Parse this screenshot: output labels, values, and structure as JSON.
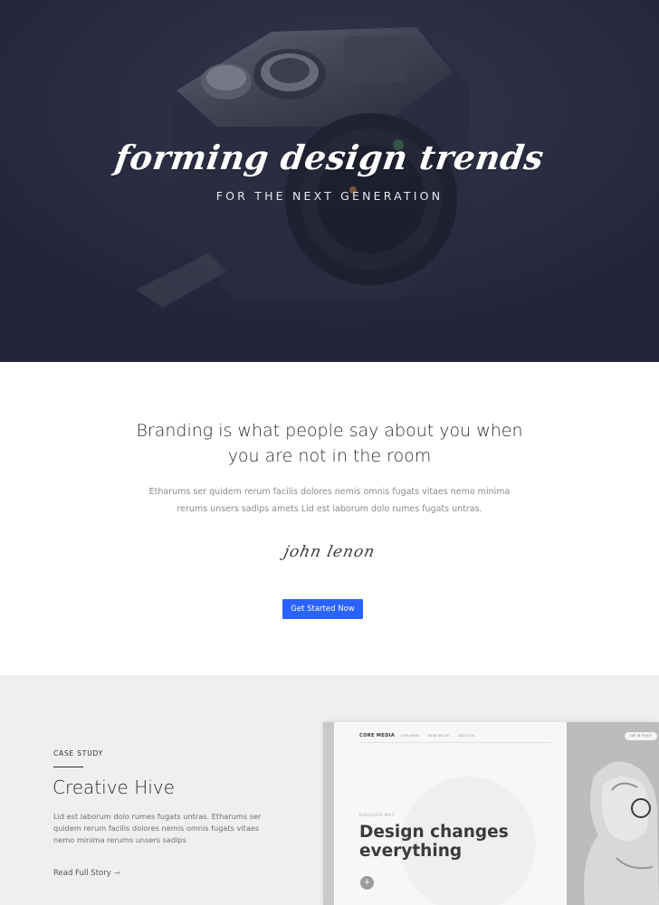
{
  "hero": {
    "title": "forming design trends",
    "subtitle": "FOR THE NEXT GENERATION",
    "photo_icon": "camera-photo",
    "background_color": "#2a2d42"
  },
  "intro": {
    "heading": "Branding is what people say about you when you are not in the room",
    "text": "Etharums ser quidem rerum facilis dolores nemis omnis fugats vitaes nemo minima rerums unsers sadips amets Lid est laborum dolo rumes fugats untras.",
    "signature": "john lenon",
    "cta_label": "Get Started Now",
    "cta_color": "#2962ff"
  },
  "case_study": {
    "eyebrow": "CASE STUDY",
    "title": "Creative Hive",
    "text": "Lid est laborum dolo rumes fugats untras. Etharums ser quidem rerum facilis dolores nemis omnis fugats vitaes nemo minima rerums unsers sadips",
    "link_label": "Read Full Story",
    "link_arrow": "→"
  },
  "mockup": {
    "logo": "CORE MEDIA",
    "nav": [
      "OUR WORK",
      "WHAT WE DO",
      "ABOUT US"
    ],
    "pill_label": "GET IN TOUCH",
    "eyebrow": "DISCOVER WHY",
    "heading": "Design changes everything",
    "plus_label": "+"
  }
}
